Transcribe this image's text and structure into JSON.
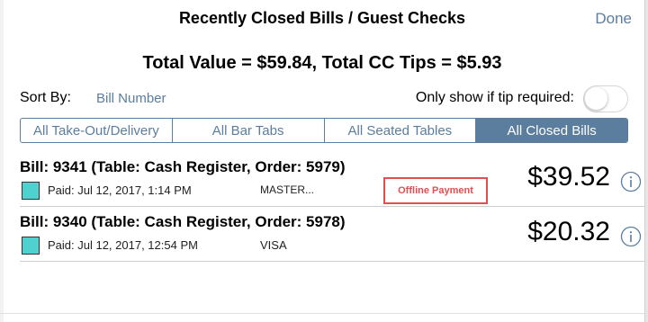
{
  "header": {
    "title": "Recently Closed Bills / Guest Checks",
    "done_label": "Done"
  },
  "totals": "Total Value = $59.84, Total CC Tips = $5.93",
  "sort": {
    "label": "Sort By:",
    "value": "Bill Number"
  },
  "tip_filter": {
    "label": "Only show if tip required:",
    "enabled": false
  },
  "segments": [
    {
      "label": "All Take-Out/Delivery",
      "active": false
    },
    {
      "label": "All Bar Tabs",
      "active": false
    },
    {
      "label": "All Seated Tables",
      "active": false
    },
    {
      "label": "All Closed Bills",
      "active": true
    }
  ],
  "bills": [
    {
      "title": "Bill: 9341 (Table: Cash Register, Order: 5979)",
      "paid": "Paid: Jul 12, 2017, 1:14 PM",
      "card": "MASTER...",
      "badge": "Offline Payment",
      "amount": "$39.52",
      "swatch_color": "#4fd2cf"
    },
    {
      "title": "Bill: 9340 (Table: Cash Register, Order: 5978)",
      "paid": "Paid: Jul 12, 2017, 12:54 PM",
      "card": "VISA",
      "badge": "",
      "amount": "$20.32",
      "swatch_color": "#4fd2cf"
    }
  ],
  "colors": {
    "accent": "#5b7d9e",
    "badge": "#e05050"
  }
}
